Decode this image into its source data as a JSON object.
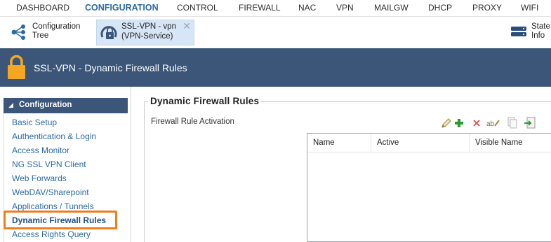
{
  "topnav": {
    "items": [
      {
        "label": "DASHBOARD",
        "active": false
      },
      {
        "label": "CONFIGURATION",
        "active": true
      },
      {
        "label": "CONTROL",
        "active": false
      },
      {
        "label": "FIREWALL",
        "active": false
      },
      {
        "label": "NAC",
        "active": false
      },
      {
        "label": "VPN",
        "active": false
      },
      {
        "label": "MAILGW",
        "active": false
      },
      {
        "label": "DHCP",
        "active": false
      },
      {
        "label": "PROXY",
        "active": false
      },
      {
        "label": "WIFI",
        "active": false
      }
    ]
  },
  "tabs": {
    "tree": {
      "line1": "Configuration",
      "line2": "Tree",
      "icon": "tree-icon"
    },
    "doc": {
      "line1": "SSL-VPN - vpn",
      "line2": "(VPN-Service)",
      "icon": "vpn-lock-icon",
      "close": "✕"
    },
    "state": {
      "line1": "State",
      "line2": "Info",
      "icon": "server-icon"
    }
  },
  "header": {
    "title": "SSL-VPN - Dynamic Firewall Rules",
    "icon": "lock-icon"
  },
  "sidebar": {
    "section": "Configuration",
    "items": [
      {
        "label": "Basic Setup",
        "selected": false
      },
      {
        "label": "Authentication & Login",
        "selected": false
      },
      {
        "label": "Access Monitor",
        "selected": false
      },
      {
        "label": "NG SSL VPN Client",
        "selected": false
      },
      {
        "label": "Web Forwards",
        "selected": false
      },
      {
        "label": "WebDAV/Sharepoint",
        "selected": false
      },
      {
        "label": "Applications / Tunnels",
        "selected": false
      },
      {
        "label": "Dynamic Firewall Rules",
        "selected": true
      },
      {
        "label": "Access Rights Query",
        "selected": false
      }
    ]
  },
  "main": {
    "group_title": "Dynamic Firewall Rules",
    "subtitle": "Firewall Rule Activation",
    "toolbar": [
      "edit-pencil-icon",
      "add-plus-icon",
      "delete-x-icon",
      "rename-abc-icon",
      "copy-icon",
      "import-icon"
    ],
    "table": {
      "columns": [
        "Name",
        "Active",
        "Visible Name"
      ],
      "rows": []
    }
  },
  "colors": {
    "brand_blue": "#3b5679",
    "active_nav": "#2a6aa6",
    "link": "#2a6aa6",
    "highlight": "#f07c1c",
    "tab_bg": "#d6e6f6",
    "lock_orange": "#f5a623"
  }
}
